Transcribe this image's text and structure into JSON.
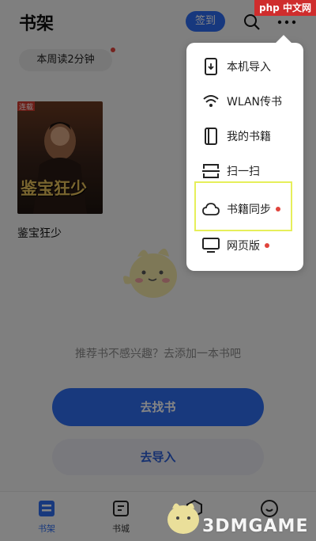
{
  "header": {
    "title": "书架",
    "checkin_label": "签到"
  },
  "reading_stat": {
    "label": "本周读2分钟"
  },
  "book": {
    "name": "鉴宝狂少",
    "cover_text": "鉴宝狂少",
    "cover_tag": "连载"
  },
  "empty_hint": "推荐书不感兴趣？去添加一本书吧",
  "buttons": {
    "find_book": "去找书",
    "import": "去导入"
  },
  "tabs": [
    {
      "label": "书架",
      "icon": "bookshelf-icon",
      "active": true
    },
    {
      "label": "书城",
      "icon": "bookstore-icon",
      "active": false
    },
    {
      "label": "",
      "icon": "discover-icon",
      "active": false
    },
    {
      "label": "",
      "icon": "profile-icon",
      "active": false
    }
  ],
  "menu": {
    "items": [
      {
        "label": "本机导入",
        "icon": "phone-import-icon",
        "dot": false
      },
      {
        "label": "WLAN传书",
        "icon": "wifi-icon",
        "dot": false
      },
      {
        "label": "我的书籍",
        "icon": "book-icon",
        "dot": false
      },
      {
        "label": "扫一扫",
        "icon": "scan-icon",
        "dot": false
      },
      {
        "label": "书籍同步",
        "icon": "cloud-icon",
        "dot": true
      },
      {
        "label": "网页版",
        "icon": "monitor-icon",
        "dot": true
      }
    ]
  },
  "watermarks": {
    "top": "php 中文网",
    "bottom": "3DMGAME"
  },
  "colors": {
    "accent": "#2f6ef0",
    "dot": "#e0443c",
    "highlight": "#e6ef5a"
  }
}
